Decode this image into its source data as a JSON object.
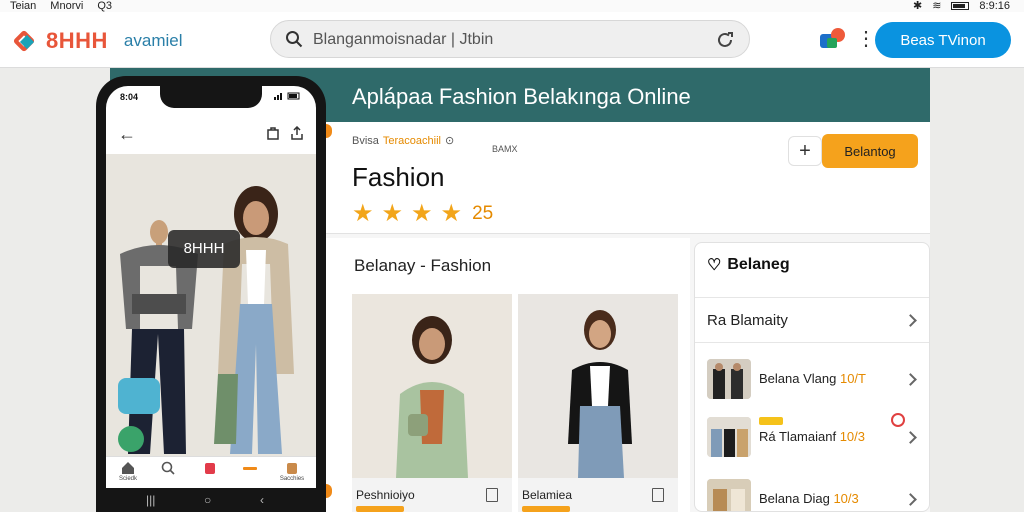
{
  "os_bar": {
    "left": [
      "Teian",
      "Mnorvi",
      "Q3"
    ],
    "right_time": "8:9:16"
  },
  "header": {
    "logo_text": "8HHH",
    "logo_sub": "avamiel",
    "search": {
      "value": "Blanganmoisnadar | Jtbin",
      "placeholder": "Blanganmoisnadar | Jtbin"
    },
    "cta_label": "Beas TVinon"
  },
  "banner": {
    "title": "Aplápaa Fashion Belakınga Online"
  },
  "product": {
    "meta_prefix": "Bvisa",
    "meta_tag": "Teracoachiil",
    "meta_right": "BAMX",
    "title": "Fashion",
    "stars": 4,
    "rating": "25",
    "plus_label": "+",
    "buy_label": "Belantog"
  },
  "section": {
    "title": "Belanay - Fashion",
    "cards": [
      {
        "name": "Peshnioiyo"
      },
      {
        "name": "Belamiea"
      }
    ]
  },
  "sidepanel": {
    "title": "Belaneg",
    "row_label": "Ra Blamaity",
    "items": [
      {
        "name": "Belana Vlang",
        "highlight": "10/T"
      },
      {
        "name": "Rá Tlamaianf",
        "highlight": "10/3"
      },
      {
        "name": "Belana Diag",
        "highlight": "10/3"
      }
    ]
  },
  "phone": {
    "time": "8:04",
    "overlay": "8HHH",
    "nav": [
      {
        "icon": "home-icon",
        "label": "Sciedk"
      },
      {
        "icon": "search-icon",
        "label": ""
      },
      {
        "icon": "bag-icon",
        "label": ""
      },
      {
        "icon": "minus-icon",
        "label": ""
      },
      {
        "icon": "profile-icon",
        "label": "Sacchies"
      }
    ]
  },
  "colors": {
    "accent": "#0a93e0",
    "brand": "#e8563a",
    "banner": "#2f6a6a",
    "orange": "#f5a21c"
  }
}
